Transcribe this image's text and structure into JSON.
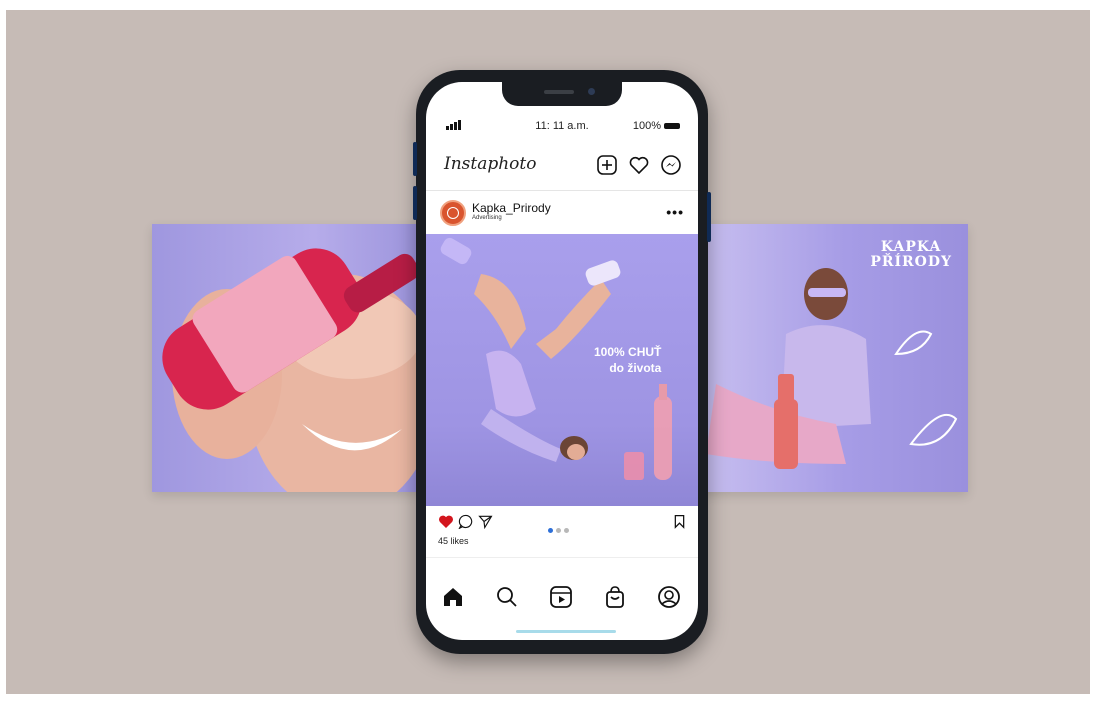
{
  "colors": {
    "backdrop": "#c6bbb6",
    "accent_purple": "#a79fe3",
    "heart_red": "#d3151d",
    "dot_active": "#2d6fd8",
    "dot_inactive": "#b8b8b8"
  },
  "status_bar": {
    "time": "11: 11 a.m.",
    "battery": "100%",
    "signal_icon": "signal-bars-icon"
  },
  "app": {
    "title": "Instaphoto",
    "header_icons": [
      "add-post-icon",
      "heart-icon",
      "messenger-icon"
    ]
  },
  "post": {
    "account_name": "Kapka_Prirody",
    "account_subtitle": "Advertising",
    "more_label": "•••",
    "overlay_line1": "100% CHUŤ",
    "overlay_line2": "do života",
    "likes": "45 likes",
    "carousel_dots": 3,
    "active_dot": 1,
    "liked": true
  },
  "side_panel": {
    "brand": "KAPKA\nPŘÍRODY"
  },
  "tabbar": {
    "icons": [
      "home-icon",
      "search-icon",
      "reels-icon",
      "shop-icon",
      "profile-icon"
    ]
  }
}
